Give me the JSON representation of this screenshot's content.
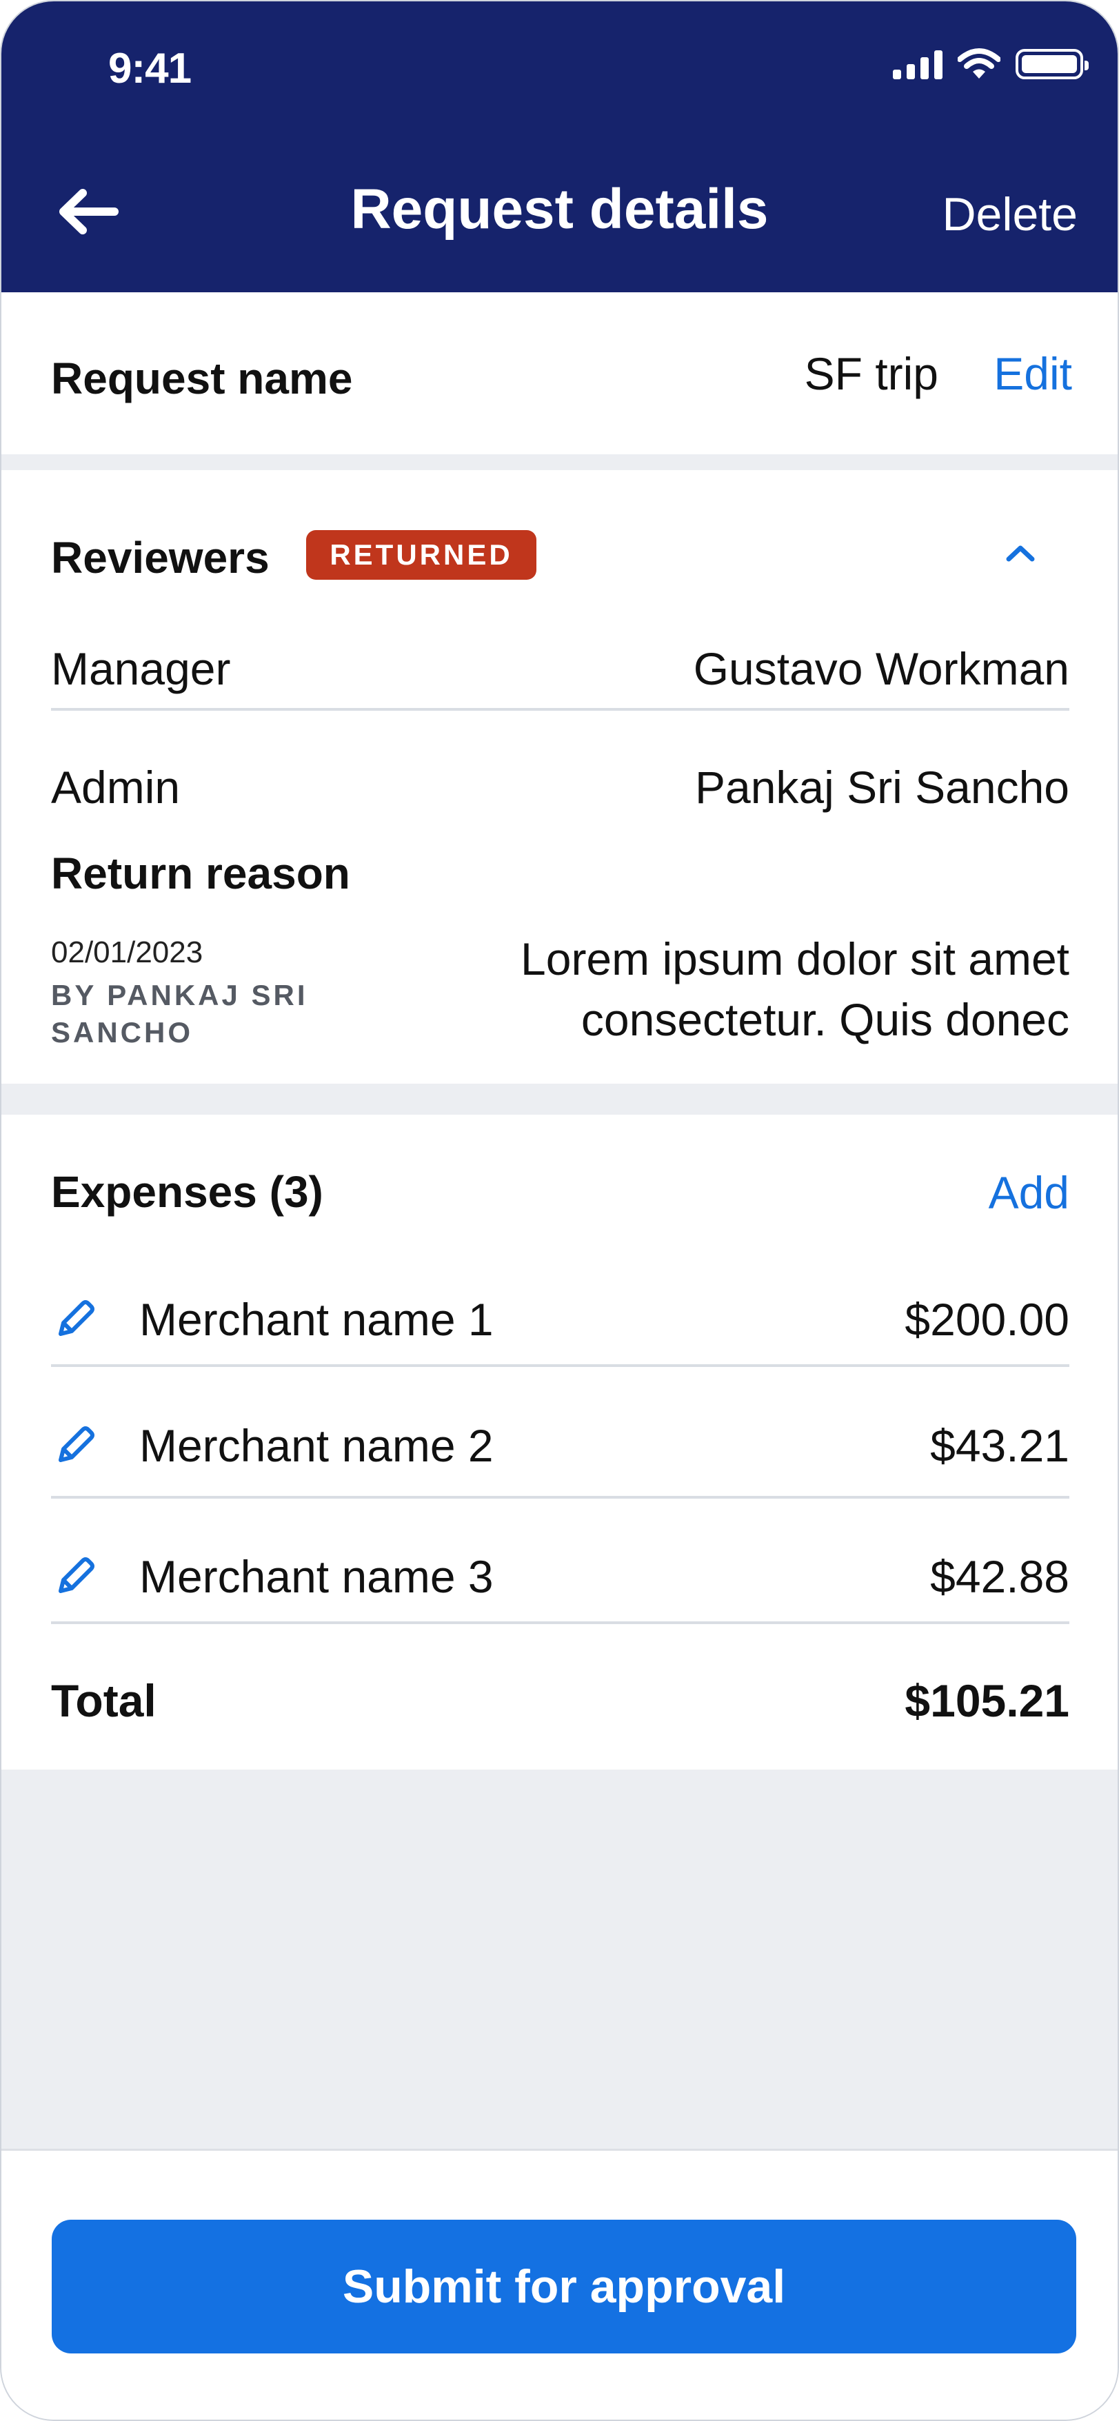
{
  "status_bar": {
    "time": "9:41"
  },
  "header": {
    "title": "Request details",
    "delete_label": "Delete"
  },
  "request": {
    "label": "Request name",
    "value": "SF trip",
    "edit_label": "Edit"
  },
  "reviewers": {
    "title": "Reviewers",
    "status_badge": "RETURNED",
    "rows": [
      {
        "role": "Manager",
        "name": "Gustavo Workman"
      },
      {
        "role": "Admin",
        "name": "Pankaj Sri Sancho"
      }
    ],
    "return_reason": {
      "label": "Return reason",
      "date": "02/01/2023",
      "by": "BY PANKAJ SRI SANCHO",
      "text": "Lorem ipsum dolor sit amet consectetur. Quis donec"
    }
  },
  "expenses": {
    "title": "Expenses (3)",
    "add_label": "Add",
    "items": [
      {
        "merchant": "Merchant name 1",
        "amount": "$200.00"
      },
      {
        "merchant": "Merchant name 2",
        "amount": "$43.21"
      },
      {
        "merchant": "Merchant name 3",
        "amount": "$42.88"
      }
    ],
    "total_label": "Total",
    "total_value": "$105.21"
  },
  "footer": {
    "submit_label": "Submit for approval"
  },
  "colors": {
    "header_bg": "#16236c",
    "accent": "#1571de",
    "badge": "#c0361c",
    "page_bg": "#eceef2"
  },
  "icons": [
    "back-arrow-icon",
    "signal-icon",
    "wifi-icon",
    "battery-icon",
    "chevron-up-icon",
    "pencil-icon"
  ]
}
